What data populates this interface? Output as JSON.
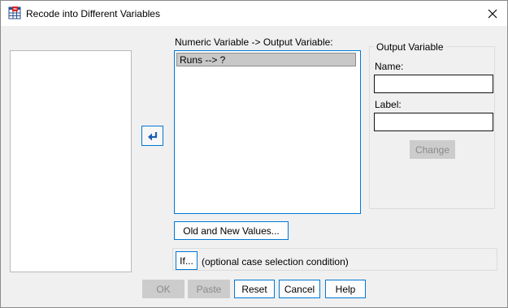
{
  "window": {
    "title": "Recode into Different Variables",
    "accent_color": "#0078d4",
    "app_icon": "spss-recode-icon",
    "close_icon": "close-icon"
  },
  "variables_panel": {
    "label": "Numeric Variable -> Output Variable:",
    "items": [
      "Runs --> ?"
    ]
  },
  "move_button": {
    "icon": "return-arrow-icon"
  },
  "output_variable": {
    "title": "Output Variable",
    "name_label": "Name:",
    "name_value": "",
    "label_label": "Label:",
    "label_value": "",
    "change_button": "Change"
  },
  "old_new_button": "Old and New Values...",
  "if_row": {
    "button": "If...",
    "description": "(optional case selection condition)"
  },
  "footer": {
    "ok": "OK",
    "paste": "Paste",
    "reset": "Reset",
    "cancel": "Cancel",
    "help": "Help"
  }
}
